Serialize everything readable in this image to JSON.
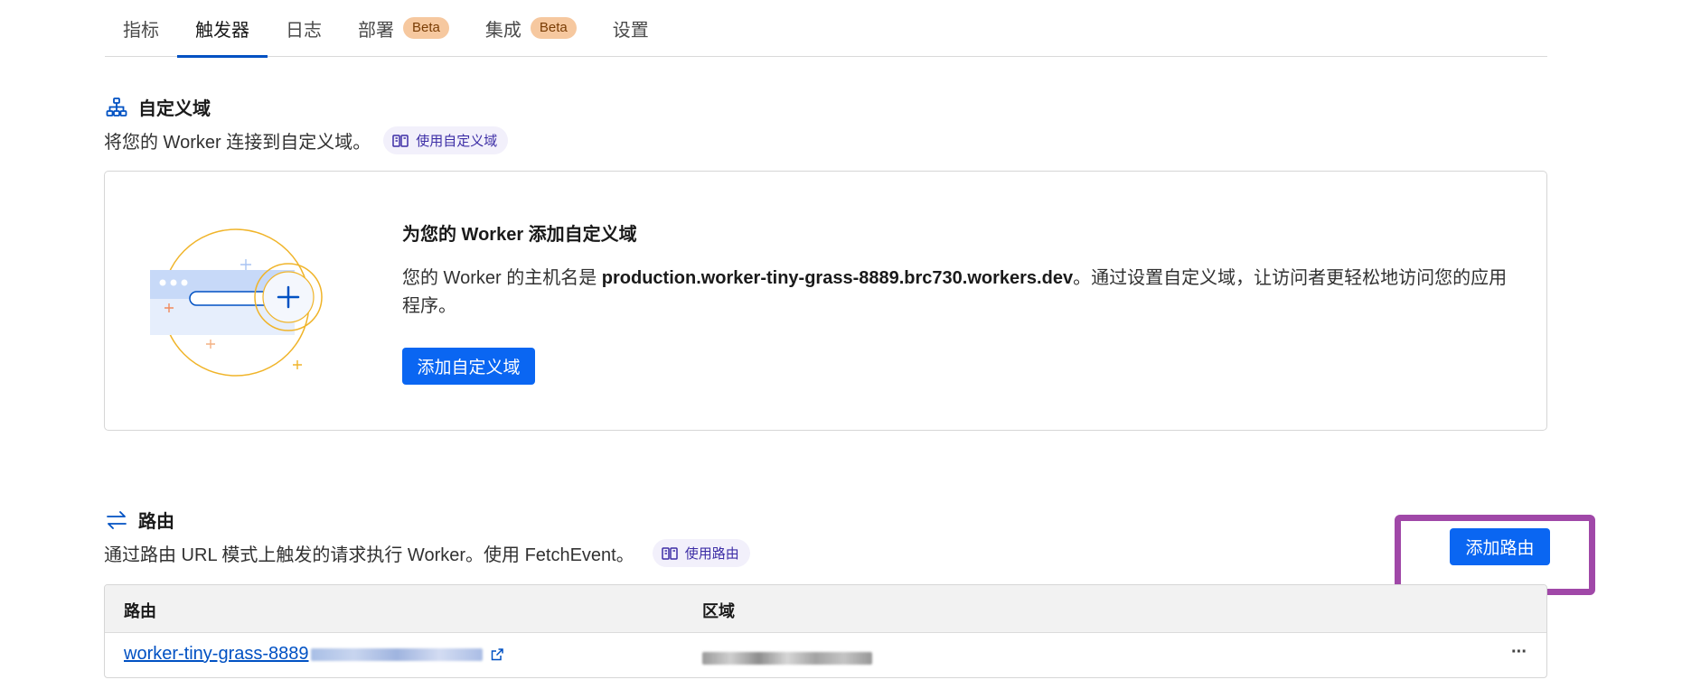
{
  "tabs": [
    {
      "label": "指标"
    },
    {
      "label": "触发器"
    },
    {
      "label": "日志"
    },
    {
      "label": "部署",
      "badge": "Beta"
    },
    {
      "label": "集成",
      "badge": "Beta"
    },
    {
      "label": "设置"
    }
  ],
  "custom_domain": {
    "title": "自定义域",
    "description": "将您的 Worker 连接到自定义域。",
    "doc_link": "使用自定义域",
    "card_title": "为您的 Worker 添加自定义域",
    "card_text_before": "您的 Worker 的主机名是 ",
    "hostname": "production.worker-tiny-grass-8889.brc730.workers.dev",
    "card_text_after": "。通过设置自定义域，让访问者更轻松地访问您的应用程序。",
    "add_button": "添加自定义域"
  },
  "routes": {
    "title": "路由",
    "description": "通过路由 URL 模式上触发的请求执行 Worker。使用 FetchEvent。",
    "doc_link": "使用路由",
    "add_button": "添加路由",
    "columns": [
      "路由",
      "区域"
    ],
    "rows": [
      {
        "route": "worker-tiny-grass-8889",
        "more": "···"
      }
    ]
  },
  "colors": {
    "primary": "#0a66f2",
    "link": "#0051c3",
    "beta_badge": "#f6c89f",
    "highlight": "#a048a8"
  }
}
